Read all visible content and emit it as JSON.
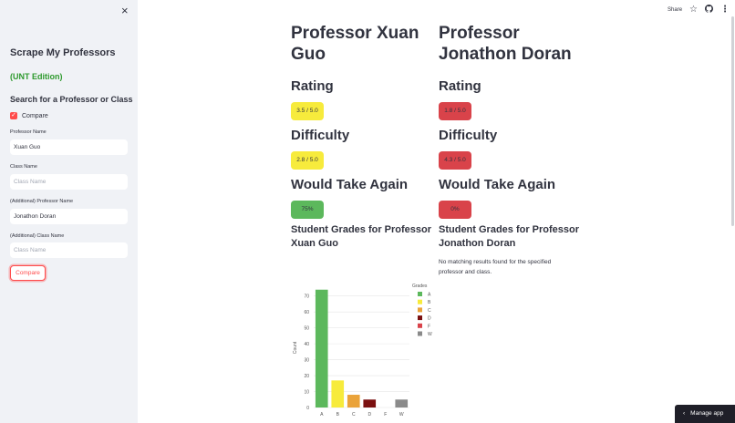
{
  "sidebar": {
    "close_icon": "×",
    "title": "Scrape My Professors",
    "edition": "(UNT Edition)",
    "search_heading": "Search for a Professor or Class",
    "compare_checkbox": {
      "label": "Compare",
      "checked": true
    },
    "fields": [
      {
        "label": "Professor Name",
        "value": "Xuan Guo",
        "placeholder": ""
      },
      {
        "label": "Class Name",
        "value": "",
        "placeholder": "Class Name"
      },
      {
        "label": "(Additional) Professor Name",
        "value": "Jonathon Doran",
        "placeholder": ""
      },
      {
        "label": "(Additional) Class Name",
        "value": "",
        "placeholder": "Class Name"
      }
    ],
    "compare_button": "Compare",
    "accent_color": "#ff4b4b"
  },
  "toolbar": {
    "share": "Share",
    "star_icon": "☆",
    "github_icon": "github-icon",
    "menu_icon": "⋮"
  },
  "professors": [
    {
      "name_line1": "Professor Xuan",
      "name_line2": "Guo",
      "rating_heading": "Rating",
      "rating": "3.5 / 5.0",
      "rating_color": "#f7eb3c",
      "difficulty_heading": "Difficulty",
      "difficulty": "2.8 / 5.0",
      "difficulty_color": "#f7eb3c",
      "take_again_heading": "Would Take Again",
      "take_again": "75%",
      "take_again_color": "#5cb85c",
      "grades_heading_line1": "Student Grades for Professor",
      "grades_heading_line2": "Xuan Guo"
    },
    {
      "name_line1": "Professor",
      "name_line2": "Jonathon Doran",
      "rating_heading": "Rating",
      "rating": "1.8 / 5.0",
      "rating_color": "#d9434a",
      "difficulty_heading": "Difficulty",
      "difficulty": "4.3 / 5.0",
      "difficulty_color": "#d9434a",
      "take_again_heading": "Would Take Again",
      "take_again": "0%",
      "take_again_color": "#d9434a",
      "grades_heading_line1": "Student Grades for Professor",
      "grades_heading_line2": "Jonathon Doran",
      "no_results": "No matching results found for the specified professor and class."
    }
  ],
  "chart_data": {
    "type": "bar",
    "categories": [
      "A",
      "B",
      "C",
      "D",
      "F",
      "W"
    ],
    "values": [
      74,
      17,
      8,
      5,
      0,
      5
    ],
    "colors": [
      "#5cb85c",
      "#f7eb3c",
      "#eaa33a",
      "#7b1010",
      "#d9434a",
      "#8a8a8a"
    ],
    "ylabel": "Count",
    "ylim": [
      0,
      75
    ],
    "yticks": [
      0,
      10,
      20,
      30,
      40,
      50,
      60,
      70
    ],
    "legend_title": "Grades",
    "legend_position": "top-right",
    "grid": true
  },
  "manage_app": "Manage app"
}
